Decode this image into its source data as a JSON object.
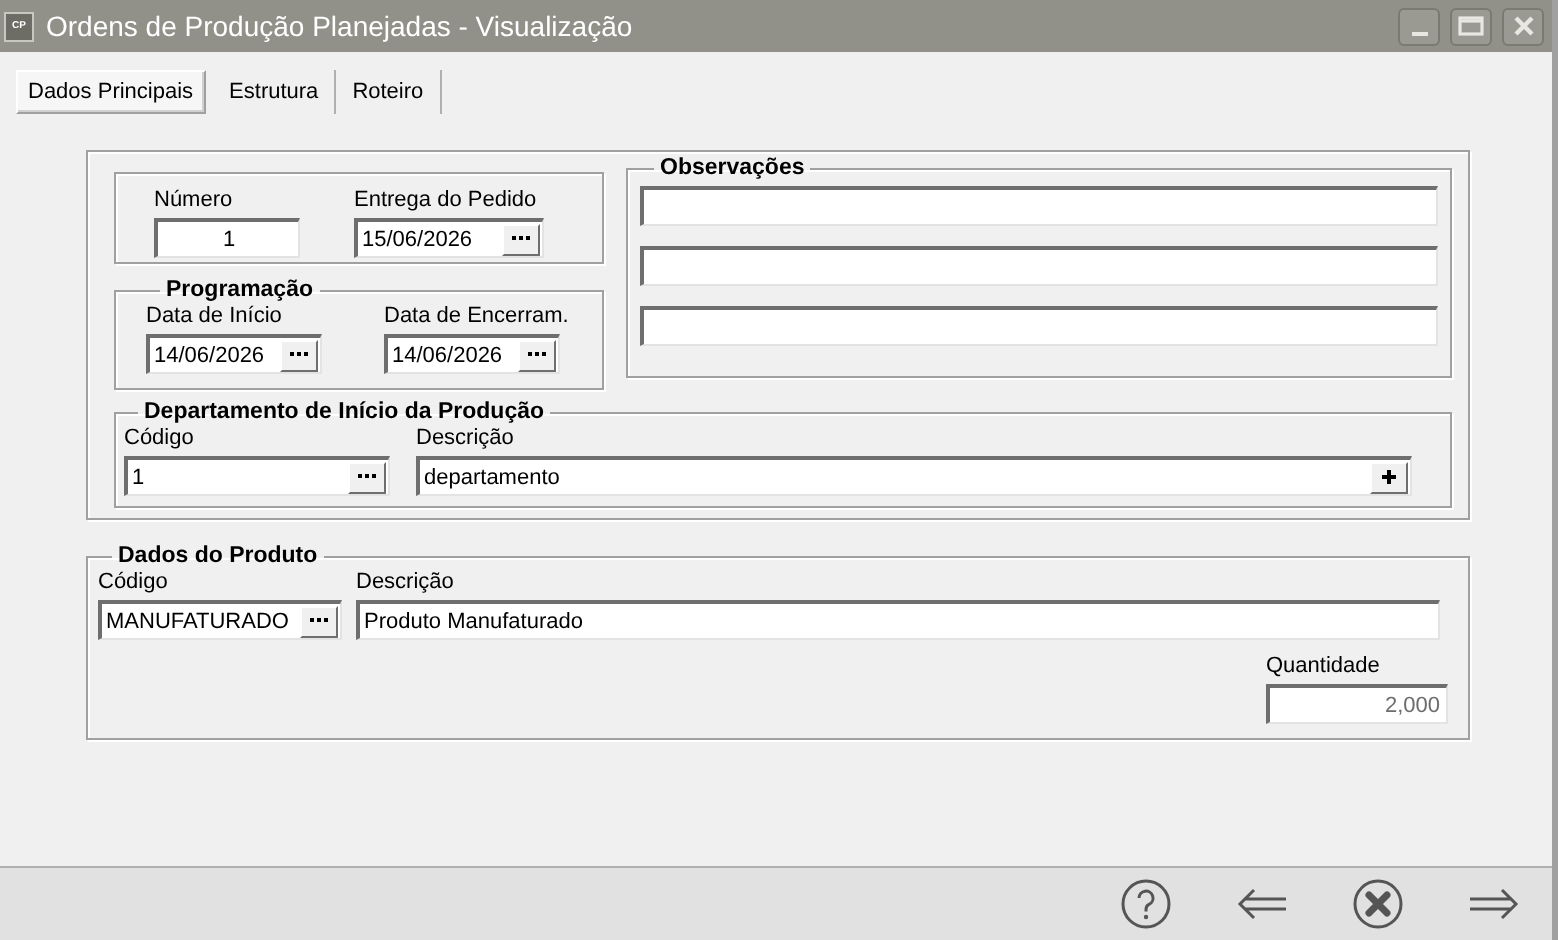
{
  "window": {
    "title": "Ordens de Produção Planejadas - Visualização",
    "badge": "CP"
  },
  "tabs": [
    {
      "label": "Dados Principais",
      "selected": true
    },
    {
      "label": "Estrutura",
      "selected": false
    },
    {
      "label": "Roteiro",
      "selected": false
    }
  ],
  "numero": {
    "label": "Número",
    "value": "1"
  },
  "entrega": {
    "label": "Entrega do Pedido",
    "value": "15/06/2026"
  },
  "programacao": {
    "title": "Programação",
    "fields": [
      {
        "label": "Data de Início",
        "value": "14/06/2026"
      },
      {
        "label": "Data de Encerram.",
        "value": "14/06/2026"
      }
    ]
  },
  "observacoes": {
    "title": "Observações",
    "lines": [
      {
        "kind": "line"
      },
      {
        "kind": "line"
      },
      {
        "kind": "line"
      }
    ]
  },
  "departamento": {
    "title": "Departamento de Início da Produção",
    "codigo": {
      "label": "Código",
      "value": "1"
    },
    "descricao": {
      "label": "Descrição",
      "value": "departamento"
    }
  },
  "produto": {
    "title": "Dados do Produto",
    "codigo": {
      "label": "Código",
      "value": "MANUFATURADO"
    },
    "descricao": {
      "label": "Descrição",
      "value": "Produto Manufaturado"
    },
    "quantidade": {
      "label": "Quantidade",
      "value": "2,000",
      "disabled": true
    }
  },
  "footer_buttons": [
    {
      "kind": "help"
    },
    {
      "kind": "back"
    },
    {
      "kind": "cancel"
    },
    {
      "kind": "next"
    }
  ]
}
